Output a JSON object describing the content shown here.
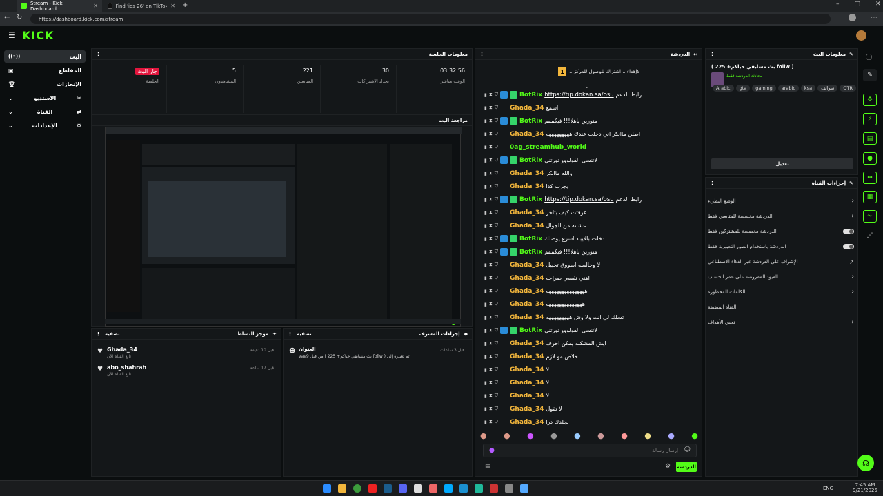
{
  "browser": {
    "tabs": [
      {
        "title": "Stream - Kick Dashboard",
        "active": true
      },
      {
        "title": "Find 'ios 26' on TikTok | TikTok Se",
        "active": false
      }
    ],
    "url": "https://dashboard.kick.com/stream"
  },
  "header": {
    "logo": "KICK"
  },
  "sidebar": {
    "items": [
      {
        "label": "البث",
        "icon": "live-icon",
        "active": true
      },
      {
        "label": "المقاطع",
        "icon": "clips-icon"
      },
      {
        "label": "الإنجازات",
        "icon": "trophy-icon"
      },
      {
        "label": "الاستديو",
        "icon": "studio-icon"
      },
      {
        "label": "القناة",
        "icon": "channel-icon"
      },
      {
        "label": "الإعدادات",
        "icon": "gear-icon"
      }
    ]
  },
  "session": {
    "title": "معلومات الجلسة",
    "stats": [
      {
        "value": "03:32:56",
        "label": "الوقت مباشر"
      },
      {
        "value": "30",
        "label": "تحداد الاشتراكات"
      },
      {
        "value": "221",
        "label": "المتابعين"
      },
      {
        "value": "5",
        "label": "المشاهدون"
      },
      {
        "value": "جار البث",
        "label": "الجلسة"
      }
    ]
  },
  "preview": {
    "title": "مراجعة البث"
  },
  "activity": {
    "title": "موجز النشاط",
    "filter": "تصفية",
    "items": [
      {
        "user": "Ghada_34",
        "sub": "تابع القناة الآن",
        "time": "قبل 10 دقيقة"
      },
      {
        "user": "abo_shahrah",
        "sub": "تابع القناة الآن",
        "time": "قبل 17 ساعة"
      }
    ]
  },
  "modactions": {
    "title": "إجراءات المشرف",
    "filter": "تصفية",
    "heading": "العنوان",
    "entry": "vae9 من قبل ( بث مسابقي حياكم+ 225 follw ) تم تغييره إلى",
    "time": "قبل 3 ساعات"
  },
  "chat": {
    "title": "الدردشة",
    "goal": "كإهداء 1 اشتراك للوصول للمركز 1",
    "goal_rank": "1",
    "lines": [
      {
        "user": "BotRix",
        "msg": "رابط الدعم",
        "link": "https://tip.dokan.sa/osu",
        "color": "#53fc18"
      },
      {
        "user": "Ghada_34",
        "msg": "اسمع",
        "color": "#f2b63c"
      },
      {
        "user": "BotRix",
        "msg": "منورين ياهلا!!! فيكممم",
        "color": "#53fc18"
      },
      {
        "user": "Ghada_34",
        "msg": "اصلن ماانكر اني دخلت عندك هههههههههه",
        "color": "#f2b63c"
      },
      {
        "user": "0ag_streamhub_world",
        "msg": "",
        "color": "#53fc18"
      },
      {
        "user": "BotRix",
        "msg": "لاتنسى الفولووو نورتني",
        "color": "#53fc18"
      },
      {
        "user": "Ghada_34",
        "msg": "والله ماانكر",
        "color": "#f2b63c"
      },
      {
        "user": "Ghada_34",
        "msg": "بجرب كذا",
        "color": "#f2b63c"
      },
      {
        "user": "BotRix",
        "msg": "رابط الدعم",
        "link": "https://tip.dokan.sa/osu",
        "color": "#53fc18"
      },
      {
        "user": "Ghada_34",
        "msg": "عرفتت كيف بتاخر",
        "color": "#f2b63c"
      },
      {
        "user": "Ghada_34",
        "msg": "عشانه من الجوال",
        "color": "#f2b63c"
      },
      {
        "user": "BotRix",
        "msg": "دخلت بالايباد اسرع يوصلك",
        "color": "#53fc18"
      },
      {
        "user": "BotRix",
        "msg": "منورين ياهلا!!! فيكممم",
        "color": "#53fc18"
      },
      {
        "user": "Ghada_34",
        "msg": "لا وجالسه اسووق تخييل",
        "color": "#f2b63c"
      },
      {
        "user": "Ghada_34",
        "msg": "اهني نفسي صراحه",
        "color": "#f2b63c"
      },
      {
        "user": "Ghada_34",
        "msg": "هههههههههههههههه",
        "color": "#f2b63c"
      },
      {
        "user": "Ghada_34",
        "msg": "ههههههههههههههه",
        "color": "#f2b63c"
      },
      {
        "user": "Ghada_34",
        "msg": "تسلك لي انت ولا وش هههههههههه",
        "color": "#f2b63c"
      },
      {
        "user": "BotRix",
        "msg": "لاتنسى الفولووو نورتني",
        "color": "#53fc18"
      },
      {
        "user": "Ghada_34",
        "msg": "ايش المشكله يمكن احرف",
        "color": "#f2b63c"
      },
      {
        "user": "Ghada_34",
        "msg": "خلاص مو لازم",
        "color": "#f2b63c"
      },
      {
        "user": "Ghada_34",
        "msg": "لا",
        "color": "#f2b63c"
      },
      {
        "user": "Ghada_34",
        "msg": "لا",
        "color": "#f2b63c"
      },
      {
        "user": "Ghada_34",
        "msg": "لا",
        "color": "#f2b63c"
      },
      {
        "user": "Ghada_34",
        "msg": "لا تقول",
        "color": "#f2b63c"
      },
      {
        "user": "Ghada_34",
        "msg": "بجلدك درا",
        "color": "#f2b63c"
      }
    ],
    "input_placeholder": "إرسال رسالة",
    "send_label": "الدردشة"
  },
  "streaminfo": {
    "title": "معلومات البث",
    "stream_title": "( بث مسابقي حياكم+ 225 follw )",
    "category": "محادثة الدردشة فقط",
    "tags": [
      "QTR",
      "سوالف",
      "ksa",
      "arabic",
      "gaming",
      "gta",
      "Arabic"
    ],
    "edit_label": "تعديل"
  },
  "channelactions": {
    "title": "إجراءات القناة",
    "items": [
      {
        "label": "الوضع البطيء",
        "control": "chevron"
      },
      {
        "label": "الدردشة مخصصة للمتابعين فقط",
        "control": "chevron"
      },
      {
        "label": "الدردشة مخصصة للمشتركين فقط",
        "control": "toggle"
      },
      {
        "label": "الدردشة باستخدام الصور التعبيرية فقط",
        "control": "toggle"
      },
      {
        "label": "الإشراف على الدردشة عبر الذكاء الاصطناعي",
        "control": "external"
      },
      {
        "label": "القيود المفروضة على عمر الحساب",
        "control": "chevron"
      },
      {
        "label": "الكلمات المحظورة",
        "control": "chevron"
      },
      {
        "label": "القناة المضيفة",
        "control": "none"
      },
      {
        "label": "تعيين الأهداف",
        "control": "chevron"
      }
    ]
  },
  "taskbar": {
    "lang": "ENG",
    "time": "7:45 AM",
    "date": "9/21/2025"
  },
  "colors": {
    "accent": "#53fc18",
    "live": "#e3163e",
    "bg": "#0b0e0f",
    "panel": "#141719"
  }
}
